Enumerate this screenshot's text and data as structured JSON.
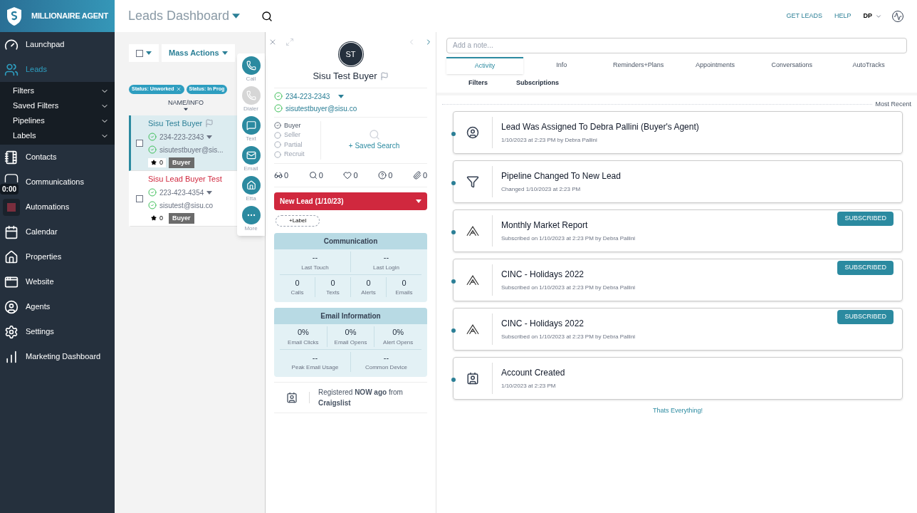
{
  "brand": "MILLIONAIRE AGENT",
  "sidebar": {
    "items": [
      {
        "label": "Launchpad",
        "selected": false
      },
      {
        "label": "Leads",
        "selected": true,
        "subitems": [
          "Filters",
          "Saved Filters",
          "Pipelines",
          "Labels"
        ]
      },
      {
        "label": "Contacts",
        "selected": false
      },
      {
        "label": "Communications",
        "selected": false,
        "badge": "0:00"
      },
      {
        "label": "Automations",
        "selected": false
      },
      {
        "label": "Calendar",
        "selected": false
      },
      {
        "label": "Properties",
        "selected": false
      },
      {
        "label": "Website",
        "selected": false
      },
      {
        "label": "Agents",
        "selected": false
      },
      {
        "label": "Settings",
        "selected": false
      },
      {
        "label": "Marketing Dashboard",
        "selected": false
      }
    ]
  },
  "header": {
    "title": "Leads Dashboard",
    "links": [
      "GET LEADS",
      "HELP"
    ],
    "user": "DP"
  },
  "leads": {
    "mass_actions": "Mass Actions",
    "chips": [
      {
        "label": "Status: Unworked",
        "removable": true
      },
      {
        "label": "Status: In Prog",
        "removable": false
      }
    ],
    "column": "NAME/INFO",
    "rows": [
      {
        "name": "Sisu Test Buyer",
        "color": "#2b7f96",
        "flagged": true,
        "phone": "234-223-2343",
        "email": "sisutestbuyer@sis...",
        "stars": "0",
        "tag": "Buyer",
        "selected": true
      },
      {
        "name": "Sisu Lead Buyer Test",
        "color": "#d0283e",
        "flagged": false,
        "phone": "223-423-4354",
        "email": "sisutest@sisu.co",
        "stars": "0",
        "tag": "Buyer",
        "selected": false
      }
    ]
  },
  "actions": [
    {
      "label": "Call",
      "disabled": false
    },
    {
      "label": "Dialer",
      "disabled": true
    },
    {
      "label": "Text",
      "disabled": false
    },
    {
      "label": "Email",
      "disabled": false
    },
    {
      "label": "Etta",
      "disabled": false
    },
    {
      "label": "More",
      "disabled": false
    }
  ],
  "detail": {
    "initials": "ST",
    "name": "Sisu Test Buyer",
    "phone": "234-223-2343",
    "email": "sisutestbuyer@sisu.co",
    "roles": [
      {
        "label": "Buyer",
        "checked": true
      },
      {
        "label": "Seller",
        "checked": false
      },
      {
        "label": "Partial",
        "checked": false
      },
      {
        "label": "Recruit",
        "checked": false
      }
    ],
    "saved_search": "+ Saved Search",
    "counts": [
      "0",
      "0",
      "0",
      "0",
      "0"
    ],
    "status": "New Lead (1/10/23)",
    "label_button": "+Label",
    "communication": {
      "title": "Communication",
      "top": [
        {
          "value": "--",
          "label": "Last Touch"
        },
        {
          "value": "--",
          "label": "Last Login"
        }
      ],
      "bottom": [
        {
          "value": "0",
          "label": "Calls"
        },
        {
          "value": "0",
          "label": "Texts"
        },
        {
          "value": "0",
          "label": "Alerts"
        },
        {
          "value": "0",
          "label": "Emails"
        }
      ]
    },
    "email_info": {
      "title": "Email Information",
      "top": [
        {
          "value": "0%",
          "label": "Email Clicks"
        },
        {
          "value": "0%",
          "label": "Email Opens"
        },
        {
          "value": "0%",
          "label": "Alert Opens"
        }
      ],
      "bottom": [
        {
          "value": "--",
          "label": "Peak Email Usage"
        },
        {
          "value": "--",
          "label": "Common Device"
        }
      ]
    },
    "registered": "Registered **NOW ago** from **Craigslist**"
  },
  "activity": {
    "note_placeholder": "Add a note...",
    "tabs": [
      {
        "label": "Activity",
        "selected": true
      },
      {
        "label": "Info",
        "selected": false
      },
      {
        "label": "Reminders+Plans",
        "selected": false
      },
      {
        "label": "Appointments",
        "selected": false
      },
      {
        "label": "Conversations",
        "selected": false
      },
      {
        "label": "AutoTracks",
        "selected": false
      }
    ],
    "subtabs": [
      "Filters",
      "Subscriptions"
    ],
    "sort": "Most Recent",
    "events": [
      {
        "kind": "user",
        "title": "Lead Was Assigned To Debra Pallini (Buyer's Agent)",
        "subtitle": "1/10/2023 at 2:23 PM by Debra Pallini"
      },
      {
        "kind": "funnel",
        "title": "Pipeline Changed To New Lead",
        "subtitle": "Changed 1/10/2023 at 2:23 PM"
      },
      {
        "kind": "subscription",
        "title": "Monthly Market Report",
        "subtitle": "Subscribed on 1/10/2023 at 2:23 PM by Debra Pallini",
        "badge": "SUBSCRIBED"
      },
      {
        "kind": "subscription",
        "title": "CINC - Holidays 2022",
        "subtitle": "Subscribed on 1/10/2023 at 2:23 PM by Debra Pallini",
        "badge": "SUBSCRIBED"
      },
      {
        "kind": "subscription",
        "title": "CINC - Holidays 2022",
        "subtitle": "Subscribed on 1/10/2023 at 2:23 PM by Debra Pallini",
        "badge": "SUBSCRIBED"
      },
      {
        "kind": "account",
        "title": "Account Created",
        "subtitle": "1/10/2023 at 2:23 PM"
      }
    ],
    "end": "Thats Everything!"
  }
}
